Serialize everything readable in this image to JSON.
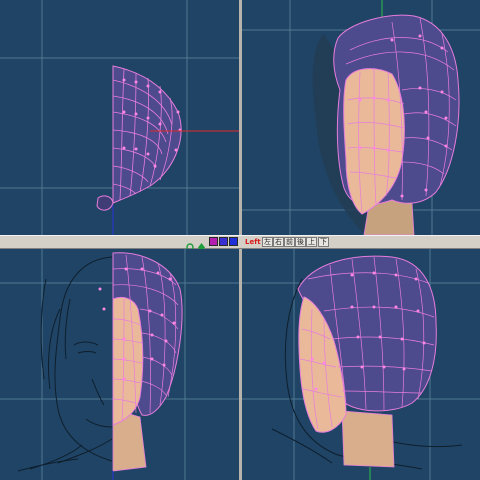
{
  "colors": {
    "viewport_bg": "#1f4466",
    "grid_line": "#4f7a93",
    "mesh_wire": "#e77ddb",
    "mesh_vertex": "#ff86e4",
    "hair_fill": "#4d4a8e",
    "skin_fill": "#e9b99a",
    "axis_red": "#e02a2a",
    "axis_green": "#2fbe48",
    "axis_blue": "#2b33d8",
    "sketch_line": "#0f1f2d",
    "toolbar_bg": "#d4d0c8"
  },
  "viewports": [
    {
      "id": "top",
      "view": "top-view"
    },
    {
      "id": "perspective",
      "view": "perspective-view"
    },
    {
      "id": "front",
      "view": "front-view-with-reference-sketch"
    },
    {
      "id": "side",
      "view": "side-view-with-reference-sketch"
    }
  ],
  "toolbar": {
    "icons": [
      "zoom-green-icon",
      "move-green-icon",
      "view-magenta-icon",
      "view-blue-icon",
      "view-blue-2-icon"
    ],
    "view_label": "Left",
    "buttons": [
      "左",
      "右",
      "前",
      "後",
      "上",
      "下"
    ],
    "highlight_color": "#d81b1b"
  }
}
